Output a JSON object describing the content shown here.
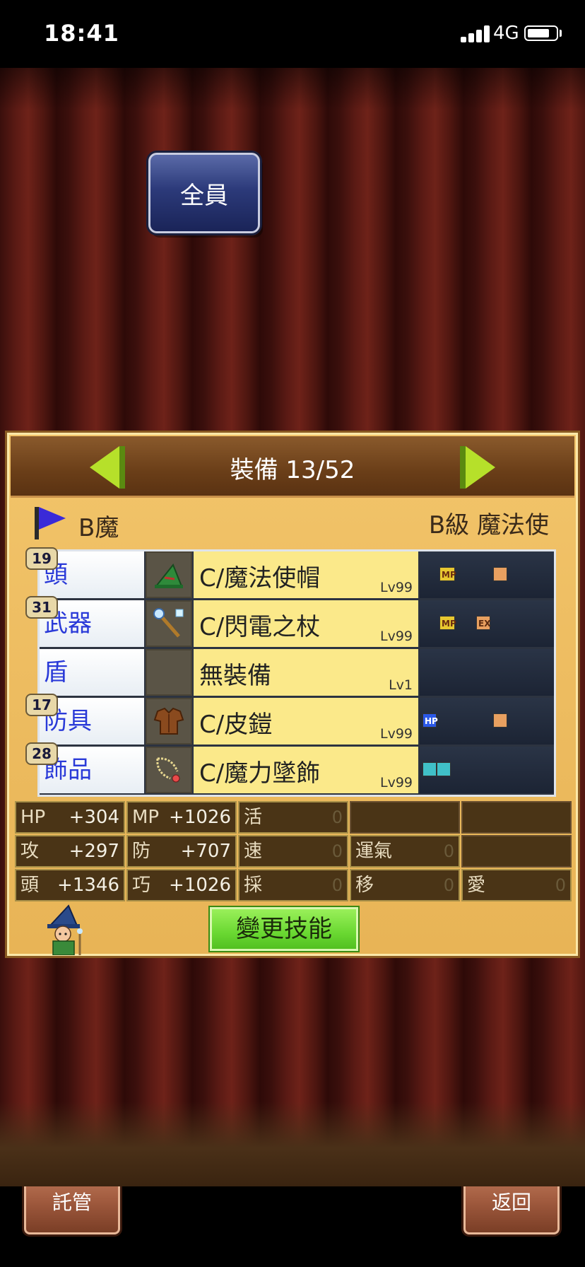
{
  "status_bar": {
    "time": "18:41",
    "network": "4G"
  },
  "top": {
    "all_button": "全員"
  },
  "panel": {
    "title": "裝備 13/52",
    "char_name": "B魔",
    "char_class": "B級 魔法使",
    "equipment": [
      {
        "slot": "頭",
        "level_badge": "19",
        "item": "C/魔法使帽",
        "lv": "Lv99",
        "icon": "wizard-hat-icon",
        "skills": [
          "MP",
          "orange"
        ]
      },
      {
        "slot": "武器",
        "level_badge": "31",
        "item": "C/閃電之杖",
        "lv": "Lv99",
        "icon": "staff-icon",
        "skills": [
          "MP",
          "EX"
        ]
      },
      {
        "slot": "盾",
        "level_badge": "",
        "item": "無裝備",
        "lv": "Lv1",
        "icon": "empty-slot-icon",
        "skills": []
      },
      {
        "slot": "防具",
        "level_badge": "17",
        "item": "C/皮鎧",
        "lv": "Lv99",
        "icon": "leather-armor-icon",
        "skills": [
          "HP",
          "orange"
        ]
      },
      {
        "slot": "飾品",
        "level_badge": "28",
        "item": "C/魔力墜飾",
        "lv": "Lv99",
        "icon": "pendant-icon",
        "skills": [
          "teal"
        ]
      }
    ],
    "stats": {
      "hp_label": "HP",
      "hp_value": "+304",
      "mp_label": "MP",
      "mp_value": "+1026",
      "vit_label": "活",
      "vit_value": "0",
      "atk_label": "攻",
      "atk_value": "+297",
      "def_label": "防",
      "def_value": "+707",
      "spd_label": "速",
      "spd_value": "0",
      "luck_label": "運氣",
      "luck_value": "0",
      "head_label": "頭",
      "head_value": "+1346",
      "skill_label": "巧",
      "skill_value": "+1026",
      "gather_label": "採",
      "gather_value": "0",
      "move_label": "移",
      "move_value": "0",
      "love_label": "愛",
      "love_value": "0"
    },
    "change_skill_button": "變更技能"
  },
  "bottom": {
    "delegate_button": "託管",
    "back_button": "返回"
  },
  "colors": {
    "accent_green": "#6ad832",
    "slot_text": "#2a3ad8",
    "item_bg": "#fbe98a"
  }
}
